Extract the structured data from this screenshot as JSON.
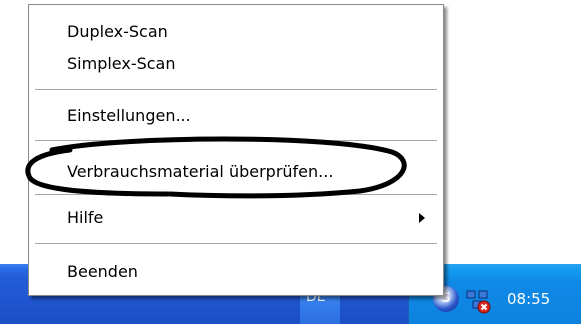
{
  "menu": {
    "items": [
      {
        "label": "Duplex-Scan"
      },
      {
        "label": "Simplex-Scan"
      },
      {
        "label": "Einstellungen..."
      },
      {
        "label": "Verbrauchsmaterial überprüfen..."
      },
      {
        "label": "Hilfe",
        "has_submenu": true
      },
      {
        "label": "Beenden"
      }
    ]
  },
  "taskbar": {
    "language": "DE",
    "tray": {
      "scan_icon_glyph": "S",
      "clock": "08:55"
    }
  },
  "colors": {
    "taskbar_blue": "#245edb",
    "tray_blue": "#0f8ae6",
    "annotation": "#000000"
  },
  "icons": [
    "submenu-arrow-icon",
    "scanner-tray-icon",
    "network-tray-icon"
  ]
}
